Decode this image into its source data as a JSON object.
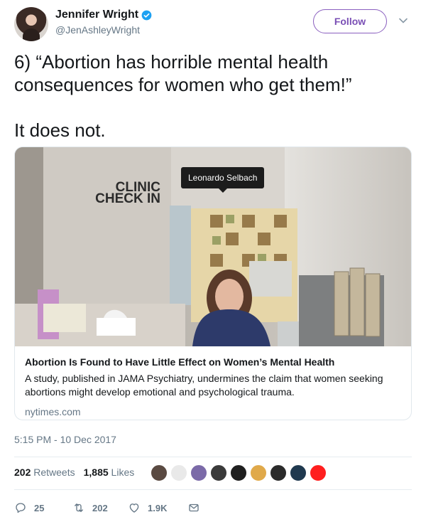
{
  "author": {
    "display_name": "Jennifer Wright",
    "handle": "@JenAshleyWright",
    "verified": true,
    "avatar_icon": "profile-photo"
  },
  "follow_label": "Follow",
  "tweet": {
    "line1": "6) “Abortion has horrible mental health",
    "line2": "consequences for women who get them!”",
    "line3": "It does not."
  },
  "card": {
    "tooltip": "Leonardo Selbach",
    "sign_line1": "CLINIC",
    "sign_line2": "CHECK IN",
    "title": "Abortion Is Found to Have Little Effect on Women’s Mental Health",
    "description": "A study, published in JAMA Psychiatry, undermines the claim that women seeking abortions might develop emotional and psychological trauma.",
    "domain": "nytimes.com"
  },
  "timestamp": "5:15 PM - 10 Dec 2017",
  "stats": {
    "retweets_count": "202",
    "retweets_label": "Retweets",
    "likes_count": "1,885",
    "likes_label": "Likes"
  },
  "likers_colors": [
    "#5a4a42",
    "#e9e9e9",
    "#7b6aa8",
    "#3a3a3a",
    "#1f1f1f",
    "#e0a94a",
    "#2b2b2b",
    "#20394f",
    "#ff1f1f"
  ],
  "actions": {
    "reply_count": "25",
    "retweet_count": "202",
    "like_count": "1.9K"
  },
  "colors": {
    "accent": "#7a4fb5",
    "verified": "#1da1f2",
    "muted": "#657786"
  }
}
